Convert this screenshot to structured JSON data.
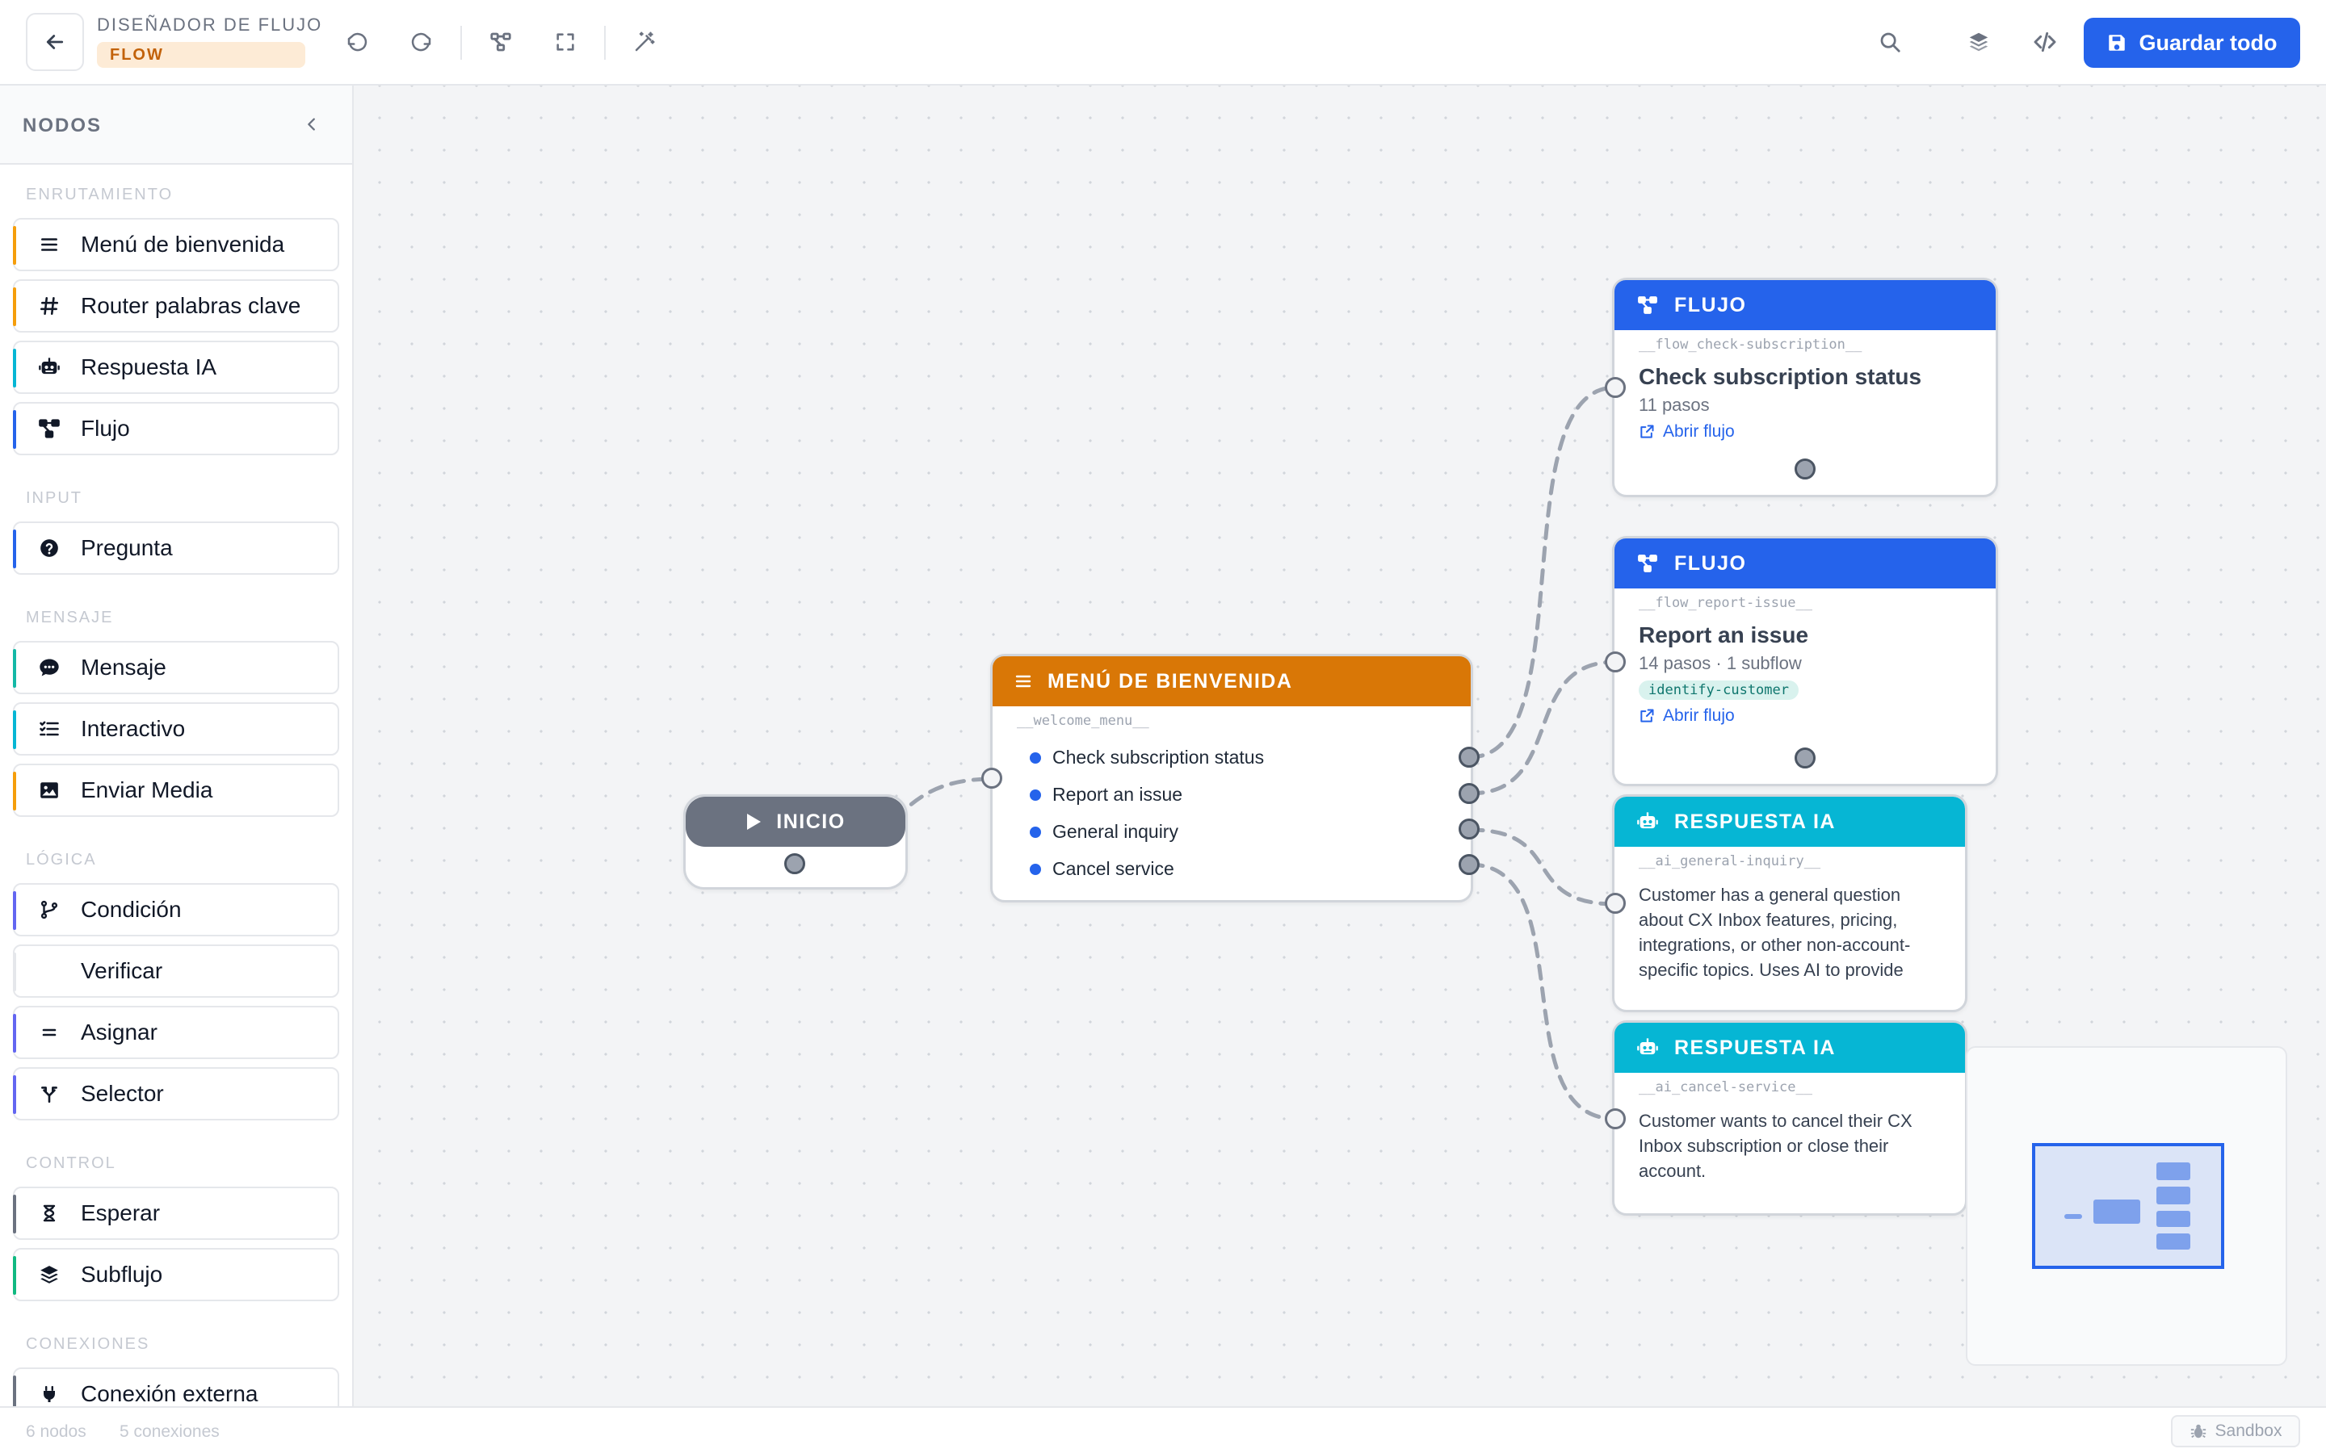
{
  "header": {
    "app_title": "DISEÑADOR DE FLUJO",
    "flow_badge": "FLOW",
    "save_label": "Guardar todo"
  },
  "sidebar": {
    "title": "NODOS",
    "sections": {
      "routing": "ENRUTAMIENTO",
      "input": "INPUT",
      "message": "MENSAJE",
      "logic": "LÓGICA",
      "control": "CONTROL",
      "connections": "CONEXIONES"
    },
    "items": [
      {
        "label": "Menú de bienvenida",
        "icon": "menu-icon",
        "accent": "#f59e0b"
      },
      {
        "label": "Router palabras clave",
        "icon": "hash-icon",
        "accent": "#f59e0b"
      },
      {
        "label": "Respuesta IA",
        "icon": "robot-icon",
        "accent": "#06b6d4"
      },
      {
        "label": "Flujo",
        "icon": "flow-icon",
        "accent": "#2563eb"
      },
      {
        "label": "Pregunta",
        "icon": "question-icon",
        "accent": "#2563eb"
      },
      {
        "label": "Mensaje",
        "icon": "chat-icon",
        "accent": "#14b8a6"
      },
      {
        "label": "Interactivo",
        "icon": "list-check-icon",
        "accent": "#06b6d4"
      },
      {
        "label": "Enviar Media",
        "icon": "image-icon",
        "accent": "#f59e0b"
      },
      {
        "label": "Condición",
        "icon": "branch-icon",
        "accent": "#6366f1"
      },
      {
        "label": "Verificar",
        "icon": "",
        "accent": "#e5e7eb"
      },
      {
        "label": "Asignar",
        "icon": "equals-icon",
        "accent": "#6366f1"
      },
      {
        "label": "Selector",
        "icon": "split-icon",
        "accent": "#6366f1"
      },
      {
        "label": "Esperar",
        "icon": "hourglass-icon",
        "accent": "#6b7280"
      },
      {
        "label": "Subflujo",
        "icon": "layers-icon",
        "accent": "#10b981"
      },
      {
        "label": "Conexión externa",
        "icon": "plug-icon",
        "accent": "#6b7280"
      }
    ]
  },
  "nodes": {
    "start": {
      "label": "INICIO"
    },
    "menu": {
      "header": "MENÚ DE BIENVENIDA",
      "id": "__welcome_menu__",
      "options": [
        "Check subscription status",
        "Report an issue",
        "General inquiry",
        "Cancel service"
      ],
      "color": "#d97706"
    },
    "flow1": {
      "header": "FLUJO",
      "id": "__flow_check-subscription__",
      "title": "Check subscription status",
      "sub": "11 pasos",
      "link": "Abrir flujo",
      "color": "#2563eb"
    },
    "flow2": {
      "header": "FLUJO",
      "id": "__flow_report-issue__",
      "title": "Report an issue",
      "sub": "14 pasos · 1 subflow",
      "tag": "identify-customer",
      "link": "Abrir flujo",
      "color": "#2563eb"
    },
    "ai1": {
      "header": "RESPUESTA IA",
      "id": "__ai_general-inquiry__",
      "desc": "Customer has a general question about CX Inbox features, pricing, integrations, or other non-account-specific topics. Uses AI to provide",
      "color": "#06b6d4"
    },
    "ai2": {
      "header": "RESPUESTA IA",
      "id": "__ai_cancel-service__",
      "desc": "Customer wants to cancel their CX Inbox subscription or close their account.",
      "color": "#06b6d4"
    }
  },
  "footer": {
    "nodes_count": "6 nodos",
    "connections_count": "5 conexiones",
    "sandbox": "Sandbox"
  }
}
